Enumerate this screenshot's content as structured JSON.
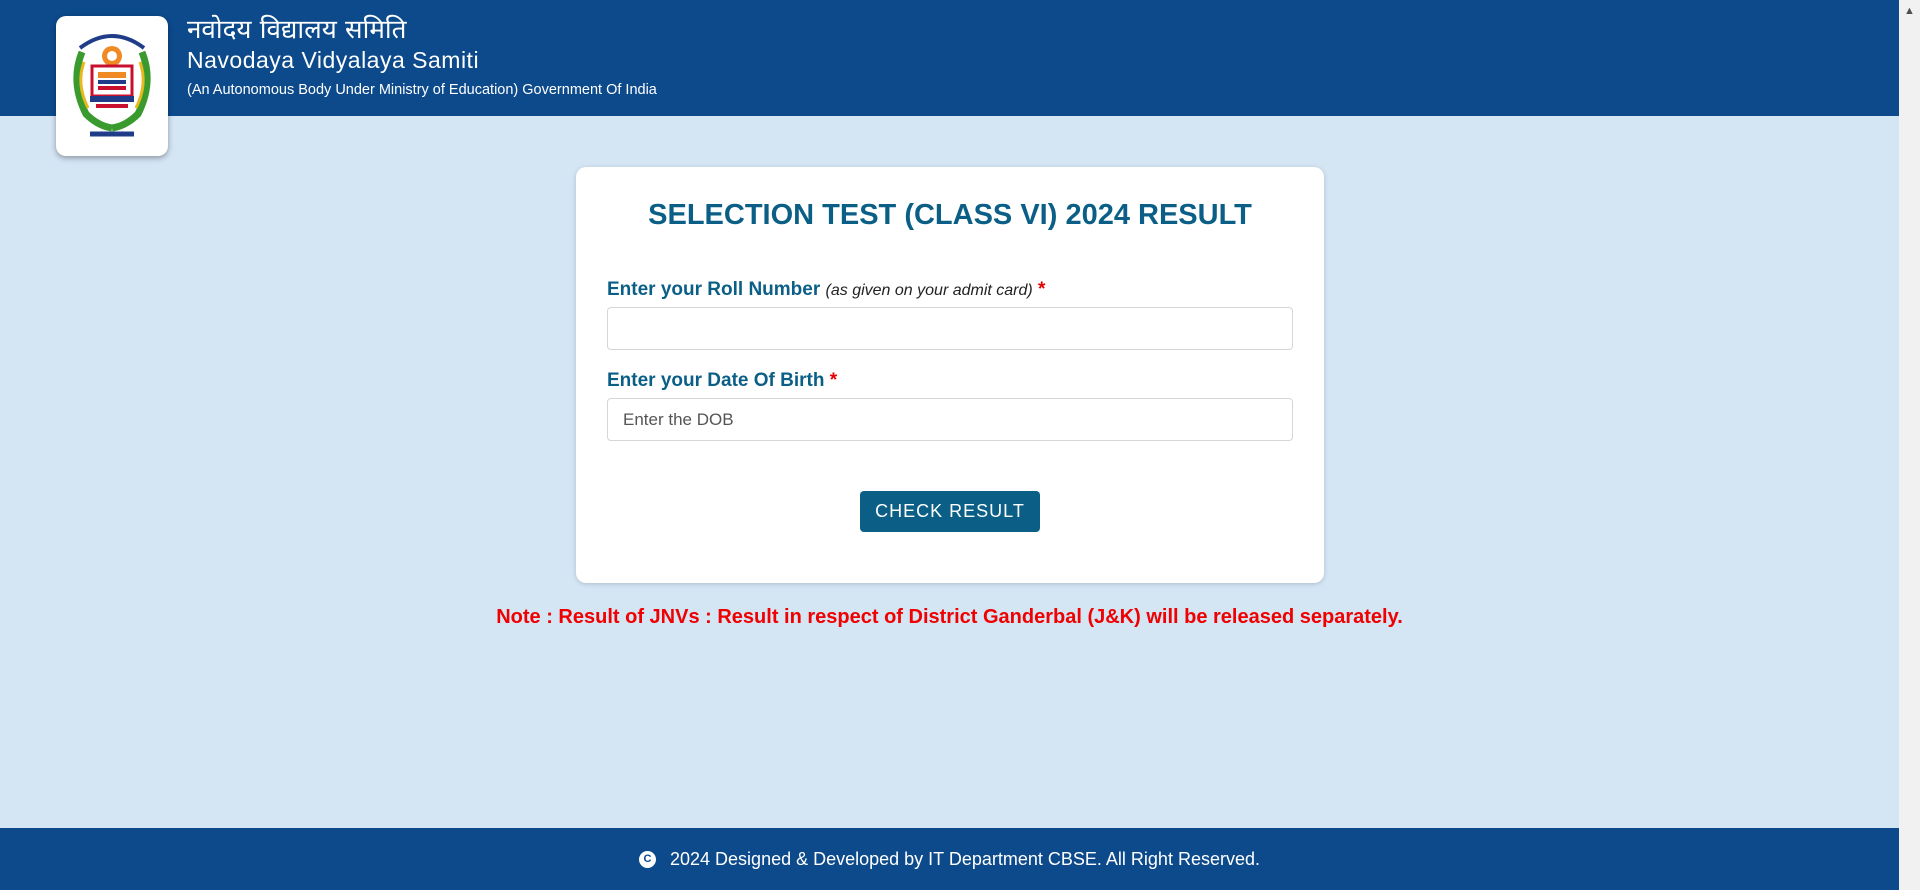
{
  "header": {
    "title_hindi": "नवोदय विद्यालय समिति",
    "title_english": "Navodaya Vidyalaya Samiti",
    "subtitle": "(An Autonomous Body Under Ministry of Education) Government Of India"
  },
  "logo": {
    "icon": "nvs-emblem-icon"
  },
  "form": {
    "title": "SELECTION TEST (CLASS VI) 2024 RESULT",
    "roll_label": "Enter your Roll Number",
    "roll_hint": "(as given on your admit card)",
    "required_mark": "*",
    "roll_value": "",
    "dob_label": "Enter your Date Of Birth",
    "dob_placeholder": "Enter the DOB",
    "submit_label": "CHECK RESULT"
  },
  "note": "Note : Result of JNVs : Result in respect of District Ganderbal (J&K) will be released separately.",
  "footer": {
    "copyright_symbol": "C",
    "text": "2024 Designed & Developed by IT Department CBSE. All Right Reserved."
  },
  "colors": {
    "header_bg": "#0c4a8b",
    "page_bg": "#d4e5f4",
    "accent": "#0b5f86",
    "note_red": "#f00000"
  }
}
